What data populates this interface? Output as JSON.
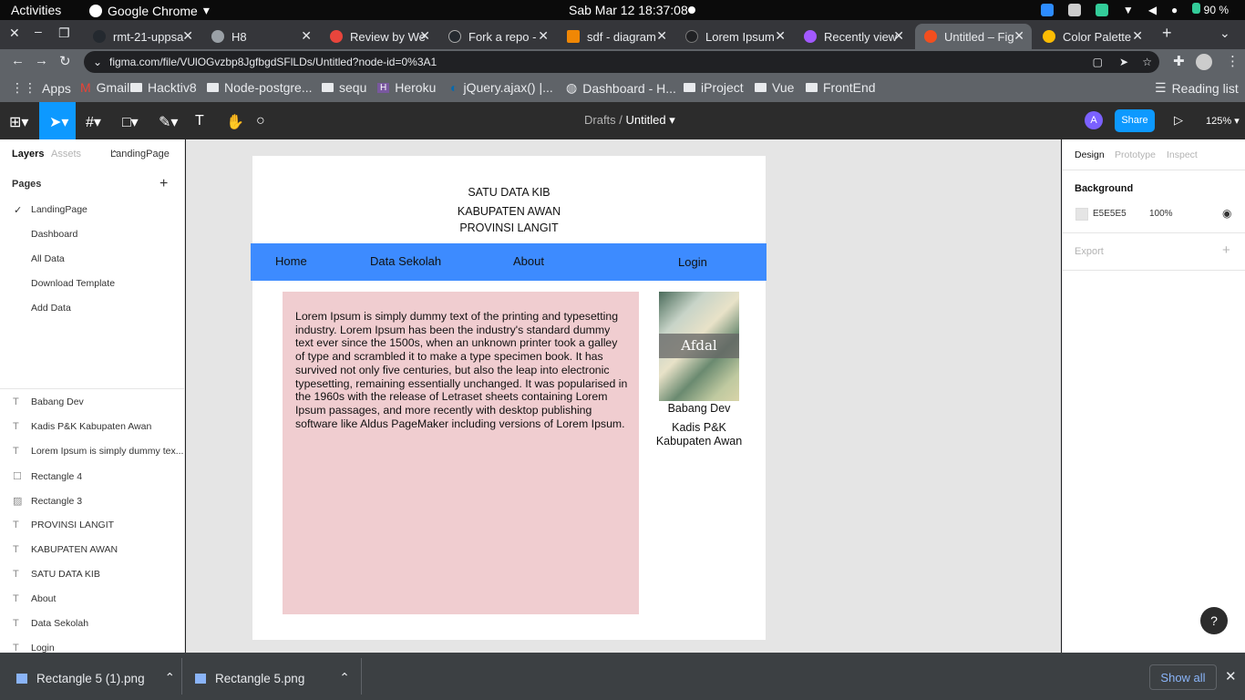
{
  "os": {
    "activities": "Activities",
    "app": "Google Chrome",
    "clock": "Sab Mar 12  18:37:08",
    "battery": "90 %"
  },
  "tabs": [
    {
      "label": "rmt-21-uppsa",
      "color": "#24292f"
    },
    {
      "label": "H8",
      "color": "#9aa0a6"
    },
    {
      "label": "Review by We",
      "color": "#e8453c"
    },
    {
      "label": "Fork a repo -",
      "color": "#24292f"
    },
    {
      "label": "sdf - diagram",
      "color": "#f08705"
    },
    {
      "label": "Lorem Ipsum",
      "color": "#202124"
    },
    {
      "label": "Recently view",
      "color": "#a259ff"
    },
    {
      "label": "Untitled – Fig",
      "color": "#f24e1e"
    },
    {
      "label": "Color Palette",
      "color": "#fbbc04"
    }
  ],
  "address": {
    "url": "figma.com/file/VUlOGvzbp8JgfbgdSFlLDs/Untitled?node-id=0%3A1"
  },
  "bookmarks": [
    "Apps",
    "Gmail",
    "Hacktiv8",
    "Node-postgre...",
    "sequ",
    "Heroku",
    "jQuery.ajax() |...",
    "Dashboard - H...",
    "iProject",
    "Vue",
    "FrontEnd",
    "Reading list"
  ],
  "figma": {
    "crumb_parent": "Drafts",
    "crumb_sep": "/",
    "crumb_title": "Untitled",
    "avatar": "A",
    "share": "Share",
    "zoom": "125%"
  },
  "left": {
    "tab_layers": "Layers",
    "tab_assets": "Assets",
    "page_select": "LandingPage",
    "pages_heading": "Pages",
    "pages": [
      "LandingPage",
      "Dashboard",
      "All Data",
      "Download Template",
      "Add Data"
    ],
    "layers": [
      {
        "icon": "T",
        "label": "Babang Dev"
      },
      {
        "icon": "T",
        "label": "Kadis P&K Kabupaten Awan"
      },
      {
        "icon": "T",
        "label": "Lorem Ipsum is simply dummy tex..."
      },
      {
        "icon": "☐",
        "label": "Rectangle 4"
      },
      {
        "icon": "▨",
        "label": "Rectangle 3"
      },
      {
        "icon": "T",
        "label": "PROVINSI LANGIT"
      },
      {
        "icon": "T",
        "label": "KABUPATEN AWAN"
      },
      {
        "icon": "T",
        "label": "SATU DATA KIB"
      },
      {
        "icon": "T",
        "label": "About"
      },
      {
        "icon": "T",
        "label": "Data Sekolah"
      },
      {
        "icon": "T",
        "label": "Login"
      }
    ]
  },
  "frame": {
    "title1": "SATU DATA KIB",
    "title2": "KABUPATEN AWAN",
    "title3": "PROVINSI LANGIT",
    "nav": {
      "home": "Home",
      "data": "Data Sekolah",
      "about": "About",
      "login": "Login"
    },
    "lorem": "Lorem Ipsum is simply dummy text of the printing and typesetting industry. Lorem Ipsum has been the industry's standard dummy text ever since the 1500s, when an unknown printer took a galley of type and scrambled it to make a type specimen book. It has survived not only five centuries, but also the leap into electronic typesetting, remaining essentially unchanged. It was popularised in the 1960s with the release of Letraset sheets containing Lorem Ipsum passages, and more recently with desktop publishing software like Aldus PageMaker including versions of Lorem Ipsum.",
    "photo_text": "Afdal",
    "name": "Babang Dev",
    "role": "Kadis P&K Kabupaten Awan"
  },
  "right": {
    "design": "Design",
    "prototype": "Prototype",
    "inspect": "Inspect",
    "background": "Background",
    "hex": "E5E5E5",
    "opacity": "100%",
    "export": "Export",
    "help": "?"
  },
  "downloads": {
    "file1": "Rectangle 5 (1).png",
    "file2": "Rectangle 5.png",
    "show_all": "Show all"
  }
}
